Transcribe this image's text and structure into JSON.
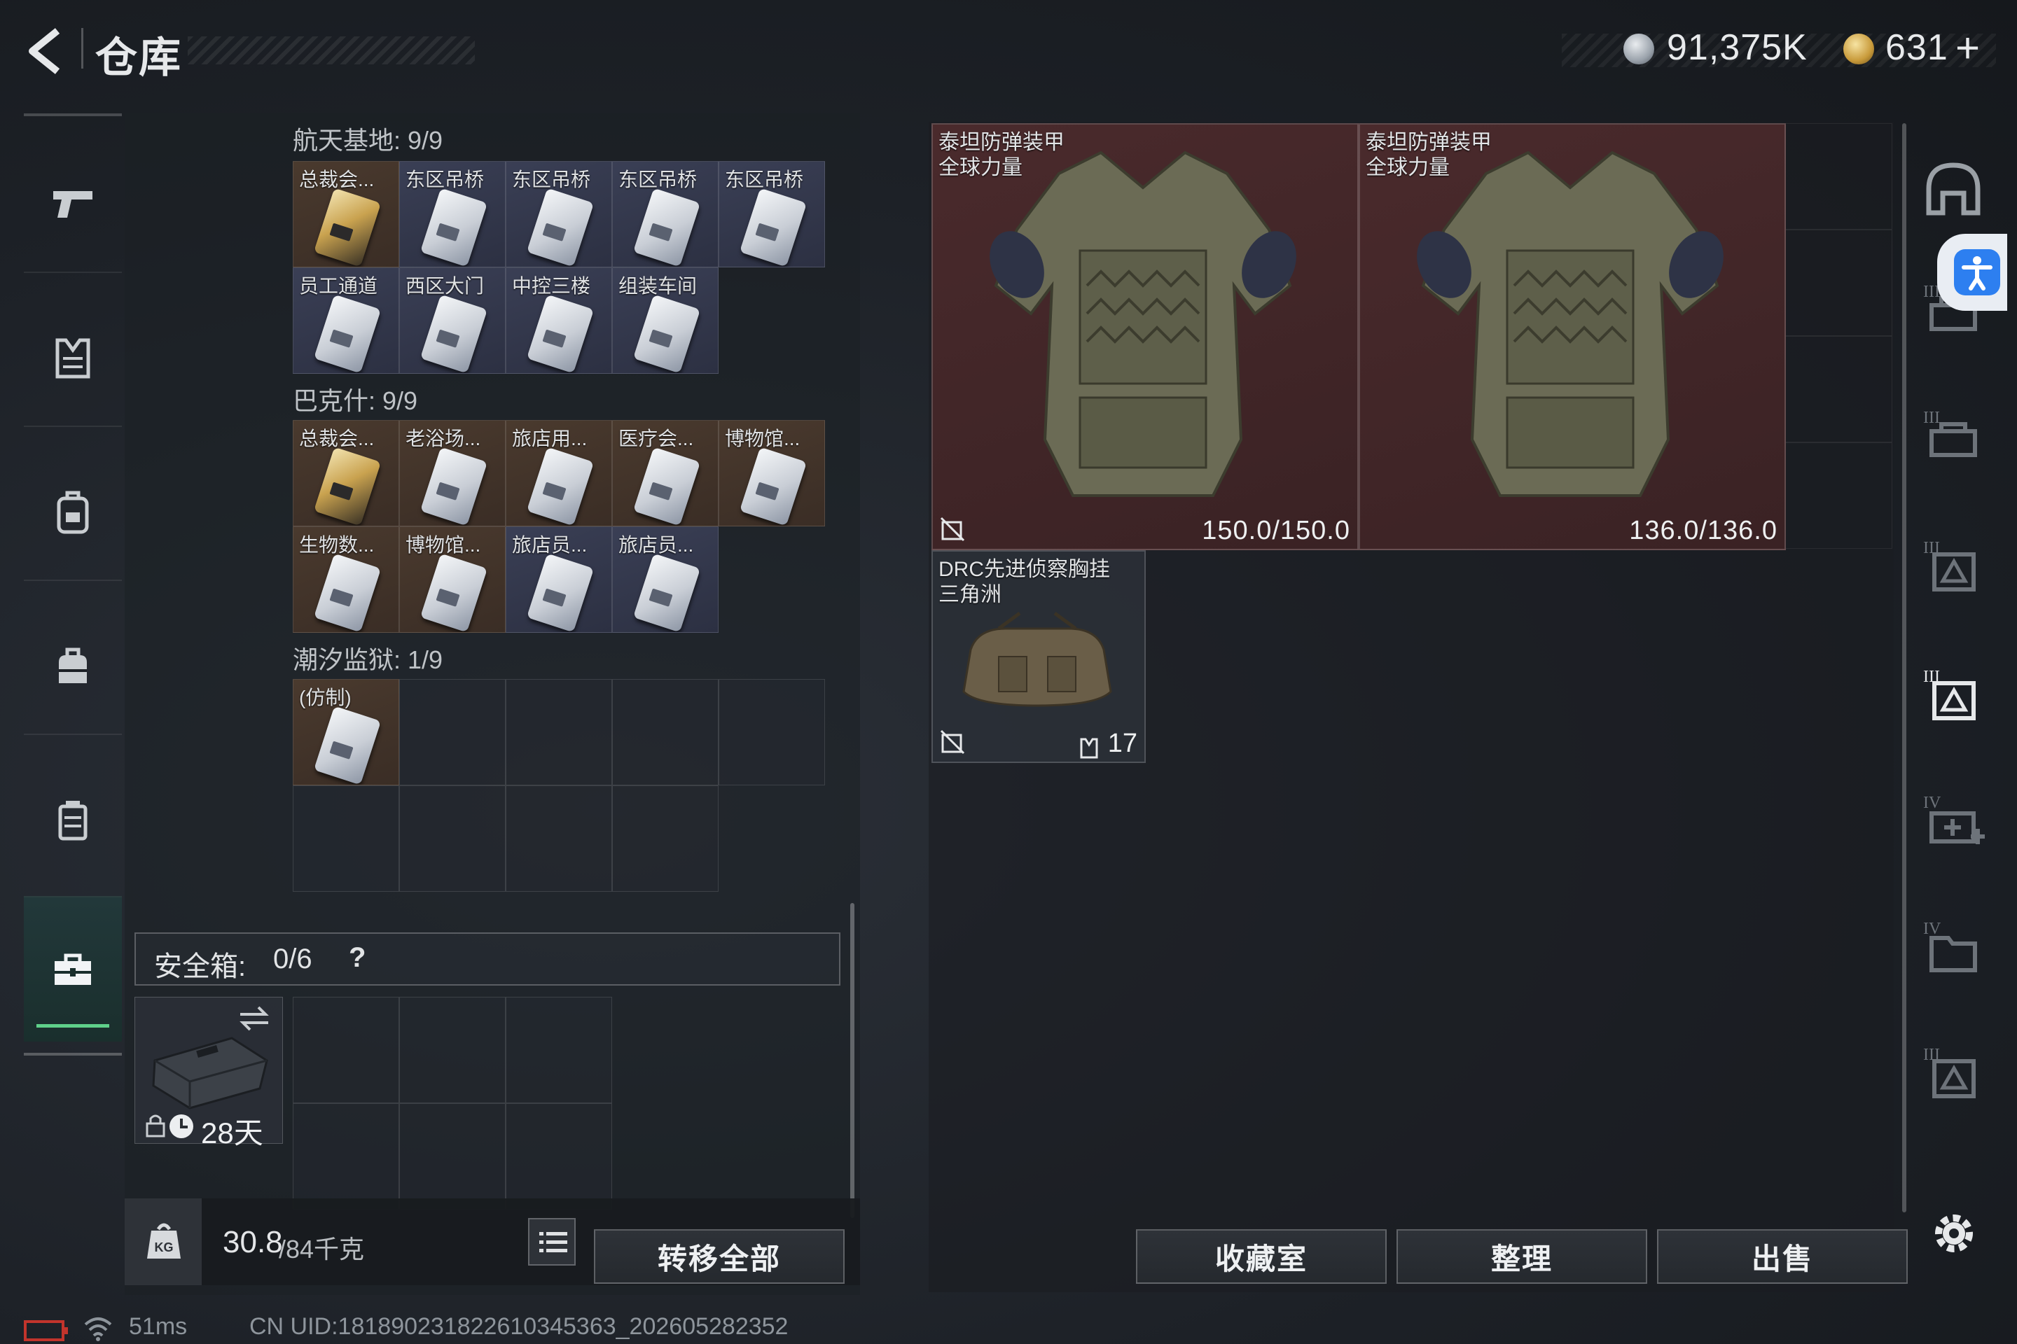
{
  "header": {
    "title": "仓库",
    "currency_a": "91,375K",
    "currency_b": "631",
    "add_label": "+"
  },
  "left_nav": {
    "items": [
      {
        "icon": "pistol-icon"
      },
      {
        "icon": "armor-vest-icon"
      },
      {
        "icon": "backpack-icon"
      },
      {
        "icon": "bag-icon"
      },
      {
        "icon": "canister-icon"
      },
      {
        "icon": "toolbox-icon",
        "active": true
      }
    ]
  },
  "sections": [
    {
      "label": "航天基地: 9/9",
      "cells": [
        {
          "label": "总裁会...",
          "type": "gold"
        },
        {
          "label": "东区吊桥",
          "type": "blue"
        },
        {
          "label": "东区吊桥",
          "type": "blue"
        },
        {
          "label": "东区吊桥",
          "type": "blue"
        },
        {
          "label": "东区吊桥",
          "type": "blue"
        },
        {
          "label": "员工通道",
          "type": "blue"
        },
        {
          "label": "西区大门",
          "type": "blue"
        },
        {
          "label": "中控三楼",
          "type": "blue"
        },
        {
          "label": "组装车间",
          "type": "blue"
        }
      ]
    },
    {
      "label": "巴克什: 9/9",
      "cells": [
        {
          "label": "总裁会...",
          "type": "gold"
        },
        {
          "label": "老浴场...",
          "type": "gold"
        },
        {
          "label": "旅店用...",
          "type": "gold"
        },
        {
          "label": "医疗会...",
          "type": "gold"
        },
        {
          "label": "博物馆...",
          "type": "gold"
        },
        {
          "label": "生物数...",
          "type": "gold"
        },
        {
          "label": "博物馆...",
          "type": "gold"
        },
        {
          "label": "旅店员...",
          "type": "blue"
        },
        {
          "label": "旅店员...",
          "type": "blue"
        }
      ]
    },
    {
      "label": "潮汐监狱: 1/9",
      "cells": [
        {
          "label": "(仿制)",
          "type": "gold"
        }
      ]
    }
  ],
  "safe_box": {
    "label": "安全箱:",
    "count": "0/6",
    "help": "?",
    "days": "28天"
  },
  "bottom": {
    "weight_current": "30.8",
    "weight_total": "/84千克",
    "transfer_all": "转移全部"
  },
  "stash_items": [
    {
      "name_line1": "泰坦防弹装甲",
      "name_line2": "全球力量",
      "durability": "150.0/150.0",
      "kind": "armor"
    },
    {
      "name_line1": "泰坦防弹装甲",
      "name_line2": "全球力量",
      "durability": "136.0/136.0",
      "kind": "armor"
    },
    {
      "name_line1": "DRC先进侦察胸挂",
      "name_line2": "三角洲",
      "count": "17",
      "kind": "rig"
    }
  ],
  "actions": {
    "collection": "收藏室",
    "sort": "整理",
    "sell": "出售"
  },
  "right_nav": {
    "icons": [
      "helmet-icon",
      "armor-tier3-icon",
      "armor-tier3-icon",
      "rig-tier3-icon",
      "rig-tier3-icon",
      "medkit-tier4-icon",
      "folder-tier4-icon",
      "rig-tier3-icon"
    ]
  },
  "status": {
    "ping": "51ms",
    "uid": "CN UID:181890231822610345363_202605282352"
  },
  "colors": {
    "accent_green": "#5fd08a",
    "armor_bg": "#4a2a2c",
    "access_blue": "#2d7ff0"
  }
}
